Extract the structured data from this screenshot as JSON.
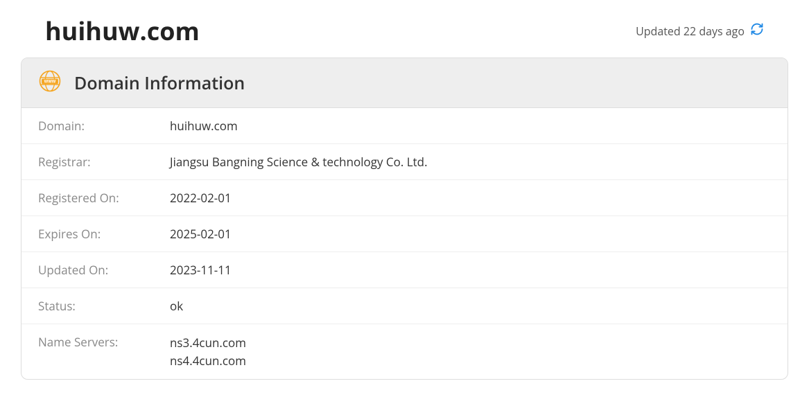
{
  "header": {
    "domain": "huihuw.com",
    "updated_text": "Updated 22 days ago"
  },
  "card": {
    "title": "Domain Information",
    "rows": {
      "domain": {
        "label": "Domain:",
        "value": "huihuw.com"
      },
      "registrar": {
        "label": "Registrar:",
        "value": "Jiangsu Bangning Science & technology Co. Ltd."
      },
      "registered_on": {
        "label": "Registered On:",
        "value": "2022-02-01"
      },
      "expires_on": {
        "label": "Expires On:",
        "value": "2025-02-01"
      },
      "updated_on": {
        "label": "Updated On:",
        "value": "2023-11-11"
      },
      "status": {
        "label": "Status:",
        "value": "ok"
      },
      "name_servers": {
        "label": "Name Servers:",
        "value1": "ns3.4cun.com",
        "value2": "ns4.4cun.com"
      }
    }
  }
}
